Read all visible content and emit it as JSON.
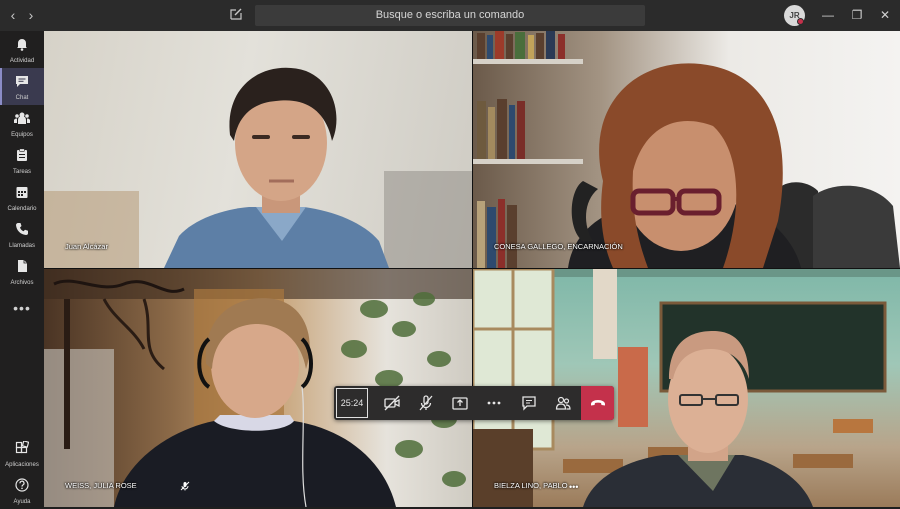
{
  "window": {
    "search_placeholder": "Busque o escriba un comando",
    "user_initials": "JR"
  },
  "rail": {
    "items": [
      {
        "label": "Actividad",
        "icon": "bell-icon"
      },
      {
        "label": "Chat",
        "icon": "chat-icon"
      },
      {
        "label": "Equipos",
        "icon": "teams-icon"
      },
      {
        "label": "Tareas",
        "icon": "tasks-icon"
      },
      {
        "label": "Calendario",
        "icon": "calendar-icon"
      },
      {
        "label": "Llamadas",
        "icon": "phone-icon"
      },
      {
        "label": "Archivos",
        "icon": "files-icon"
      }
    ],
    "more": "•••",
    "apps_label": "Aplicaciones",
    "help_label": "Ayuda"
  },
  "participants": [
    {
      "name": "Juan Alcázar"
    },
    {
      "name": "CONESA GALLEGO, ENCARNACIÓN"
    },
    {
      "name": "WEISS, JULIA ROSE"
    },
    {
      "name": "BIELZA LINO, PABLO"
    }
  ],
  "call": {
    "timer": "25:24",
    "more_dots": "•••"
  },
  "colors": {
    "accent": "#8b8cc7",
    "hangup": "#c4314b",
    "titlebar": "#2b2b2b",
    "rail": "#201f1f"
  }
}
